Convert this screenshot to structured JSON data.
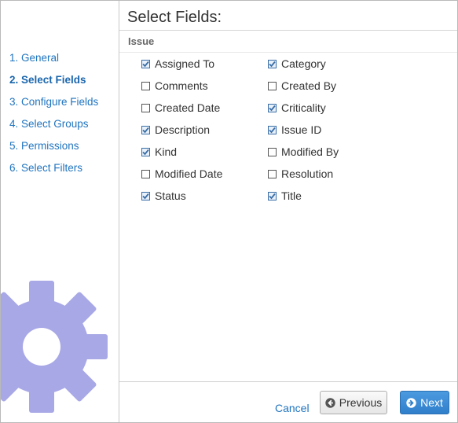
{
  "sidebar": {
    "steps": [
      {
        "label": "1. General",
        "active": false
      },
      {
        "label": "2. Select Fields",
        "active": true
      },
      {
        "label": "3. Configure Fields",
        "active": false
      },
      {
        "label": "4. Select Groups",
        "active": false
      },
      {
        "label": "5. Permissions",
        "active": false
      },
      {
        "label": "6. Select Filters",
        "active": false
      }
    ],
    "decoration_icon": "gear-icon",
    "decoration_color": "#a8a8e6"
  },
  "main": {
    "title": "Select Fields:",
    "section_label": "Issue",
    "fields_left": [
      {
        "label": "Assigned To",
        "checked": true
      },
      {
        "label": "Comments",
        "checked": false
      },
      {
        "label": "Created Date",
        "checked": false
      },
      {
        "label": "Description",
        "checked": true
      },
      {
        "label": "Kind",
        "checked": true
      },
      {
        "label": "Modified Date",
        "checked": false
      },
      {
        "label": "Status",
        "checked": true
      }
    ],
    "fields_right": [
      {
        "label": "Category",
        "checked": true
      },
      {
        "label": "Created By",
        "checked": false
      },
      {
        "label": "Criticality",
        "checked": true
      },
      {
        "label": "Issue ID",
        "checked": true
      },
      {
        "label": "Modified By",
        "checked": false
      },
      {
        "label": "Resolution",
        "checked": false
      },
      {
        "label": "Title",
        "checked": true
      }
    ]
  },
  "footer": {
    "cancel_label": "Cancel",
    "previous_label": "Previous",
    "previous_icon": "arrow-left-circle-icon",
    "next_label": "Next",
    "next_icon": "arrow-right-circle-icon"
  },
  "colors": {
    "link": "#1f74bf",
    "primary_button": "#2f7fcb",
    "checkbox_check": "#3a6ea5"
  }
}
